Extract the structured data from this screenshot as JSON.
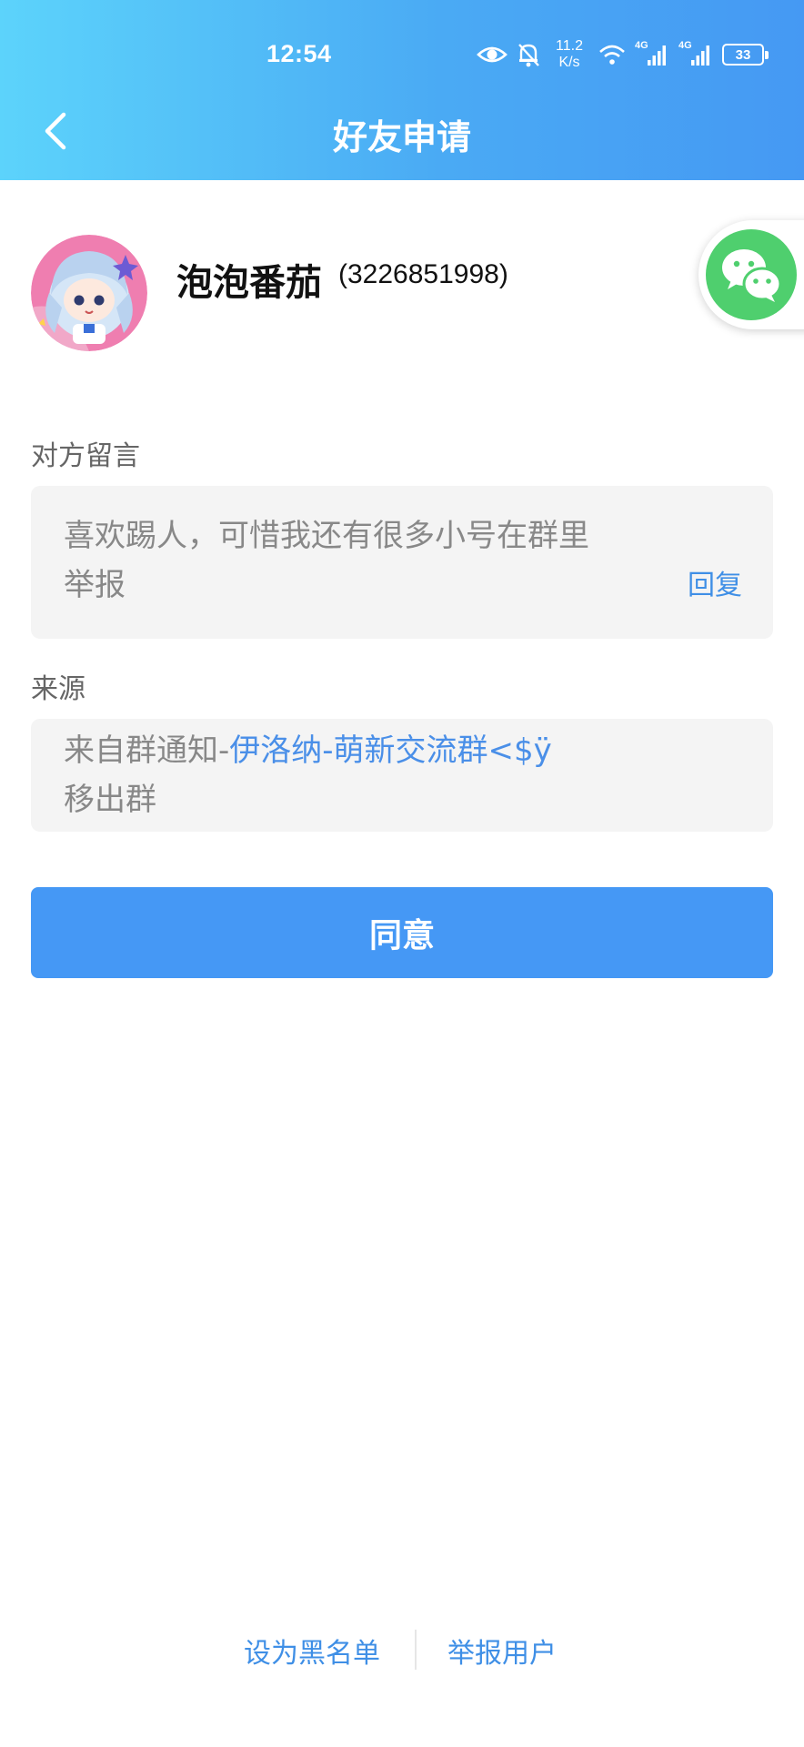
{
  "status_bar": {
    "time": "12:54",
    "net_speed_value": "11.2",
    "net_speed_unit": "K/s",
    "sim1_type": "4G",
    "sim2_type": "4G",
    "battery": "33"
  },
  "header": {
    "title": "好友申请"
  },
  "profile": {
    "name": "泡泡番茄",
    "id": "(3226851998)"
  },
  "message_section": {
    "label": "对方留言",
    "line1": "喜欢踢人，可惜我还有很多小号在群里",
    "line2": "举报",
    "reply_label": "回复"
  },
  "source_section": {
    "label": "来源",
    "prefix": "来自群通知-",
    "group_link": "伊洛纳-萌新交流群<$ÿ",
    "line2": "移出群"
  },
  "actions": {
    "agree_label": "同意",
    "blacklist_label": "设为黑名单",
    "report_label": "举报用户"
  },
  "colors": {
    "header_gradient_start": "#5cd3fb",
    "header_gradient_end": "#4599f3",
    "primary_button": "#4598f5",
    "link": "#3f8fe6",
    "wechat_green": "#4fcf6e"
  }
}
